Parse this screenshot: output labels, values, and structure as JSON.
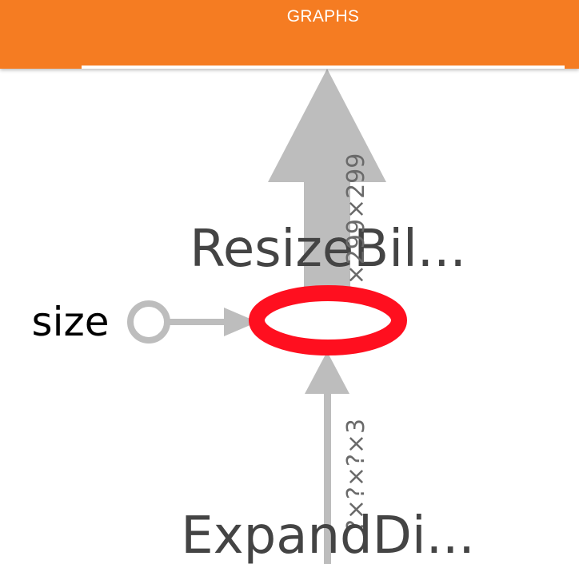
{
  "tabs": {
    "active_label": "GRAPHS"
  },
  "graph": {
    "nodes": {
      "resize": {
        "label": "ResizeBil..."
      },
      "expand": {
        "label": "ExpandDi..."
      },
      "size": {
        "label": "size"
      }
    },
    "edges": {
      "resize_out": {
        "shape_label": "?×299×299"
      },
      "expand_to_resize": {
        "shape_label": "?×?×?×3"
      }
    },
    "colors": {
      "header": "#f57c22",
      "edge": "#bdbdbd",
      "selected_node": "#ff0f1f",
      "label": "#444444"
    }
  }
}
